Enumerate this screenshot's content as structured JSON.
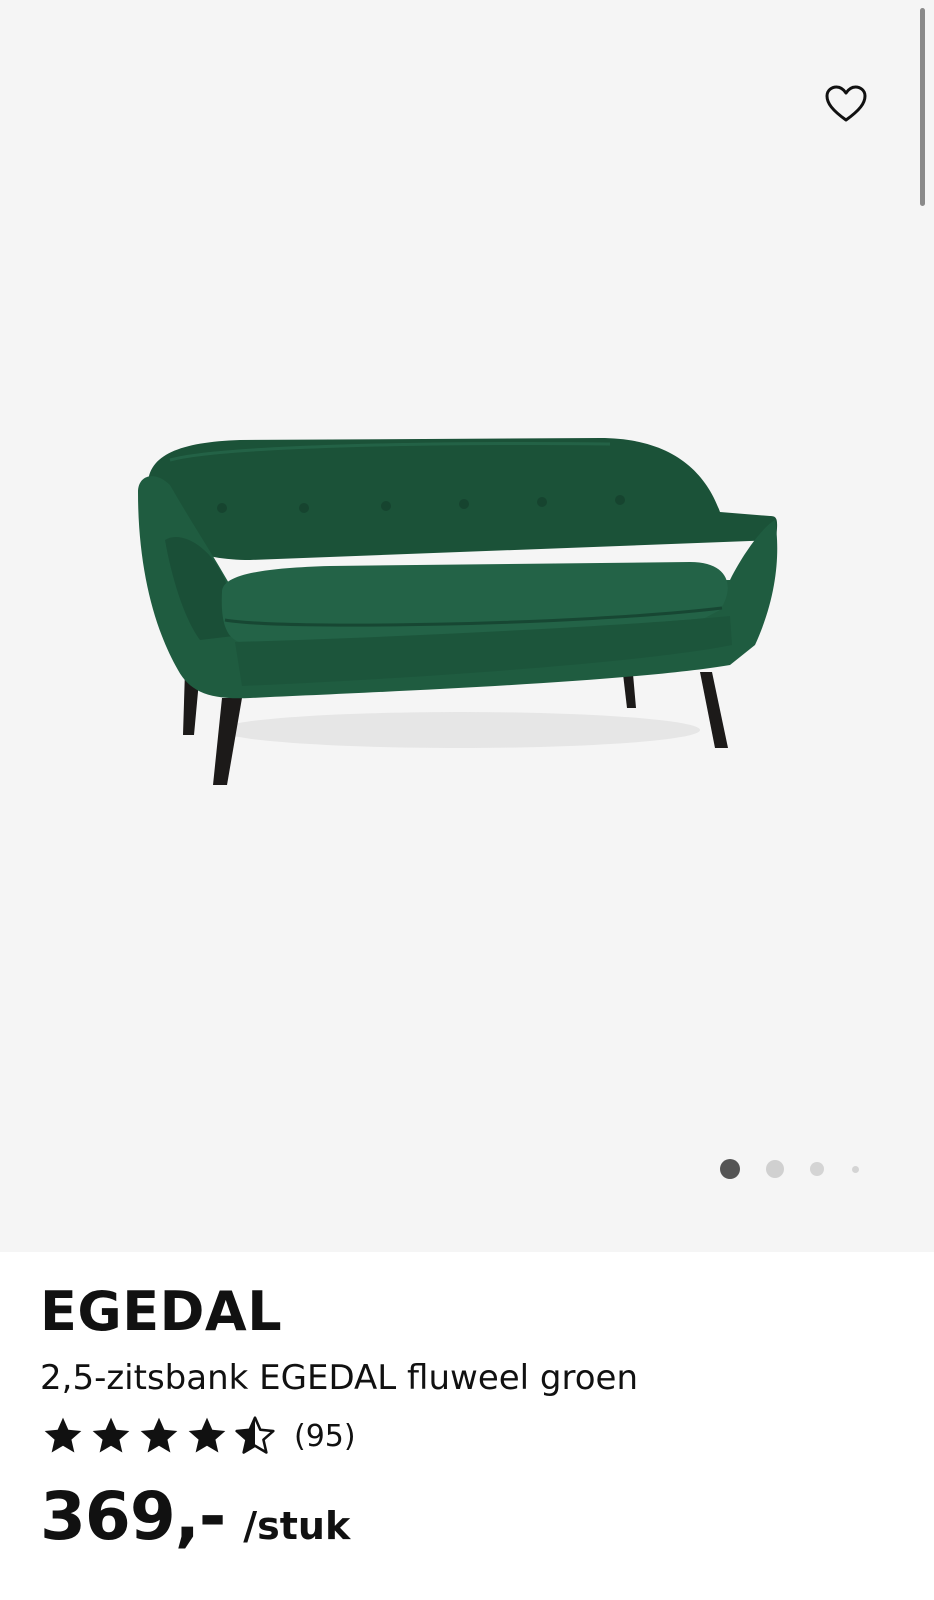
{
  "product": {
    "brand": "EGEDAL",
    "description": "2,5-zitsbank EGEDAL fluweel groen",
    "rating": 4.5,
    "rating_max": 5,
    "review_count": "(95)",
    "price": "369,-",
    "unit": "/stuk"
  },
  "gallery": {
    "image_count": 4,
    "active_index": 0
  },
  "icons": {
    "favorite": "heart-outline-icon",
    "star": "star-icon"
  },
  "colors": {
    "sofa_green": "#1e5a3e",
    "gallery_bg": "#f5f5f5",
    "active_dot": "#555555",
    "inactive_dot": "#d0d0d0"
  }
}
